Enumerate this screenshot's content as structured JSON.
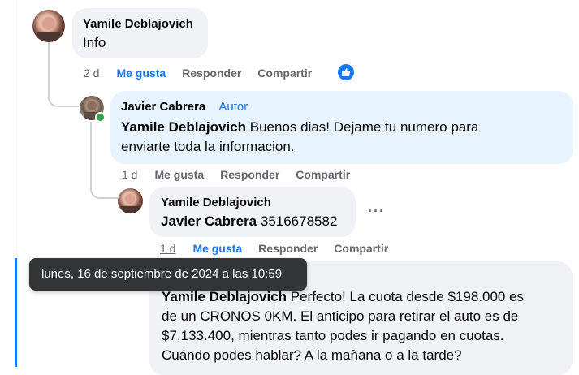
{
  "comments": [
    {
      "author": "Yamile Deblajovich",
      "text": "Info",
      "actions": {
        "time": "2 d",
        "like": "Me gusta",
        "reply": "Responder",
        "share": "Compartir"
      }
    },
    {
      "author": "Javier Cabrera",
      "badge": "Autor",
      "mention": "Yamile Deblajovich",
      "text_line1": " Buenos dias! Dejame tu numero para",
      "text_line2": "enviarte toda la informacion.",
      "actions": {
        "time": "1 d",
        "like": "Me gusta",
        "reply": "Responder",
        "share": "Compartir"
      }
    },
    {
      "author": "Yamile Deblajovich",
      "mention": "Javier Cabrera",
      "text": " 3516678582",
      "more": "···",
      "actions": {
        "time": "1 d",
        "like": "Me gusta",
        "reply": "Responder",
        "share": "Compartir"
      }
    },
    {
      "mention": "Yamile Deblajovich",
      "text_line1": " Perfecto! La cuota desde $198.000 es",
      "text_line2": "de un CRONOS 0KM. El anticipo para retirar el auto es de",
      "text_line3": "$7.133.400, mientras tanto podes ir pagando en cuotas.",
      "text_line4": "Cuándo podes hablar? A la mañana o a la tarde?"
    }
  ],
  "tooltip": "lunes, 16 de septiembre de 2024 a las 10:59",
  "colors": {
    "link": "#1877f2",
    "bubble": "#f0f2f5",
    "highlight": "#e7f3ff",
    "tooltip": "#323436",
    "online": "#31a24c"
  }
}
